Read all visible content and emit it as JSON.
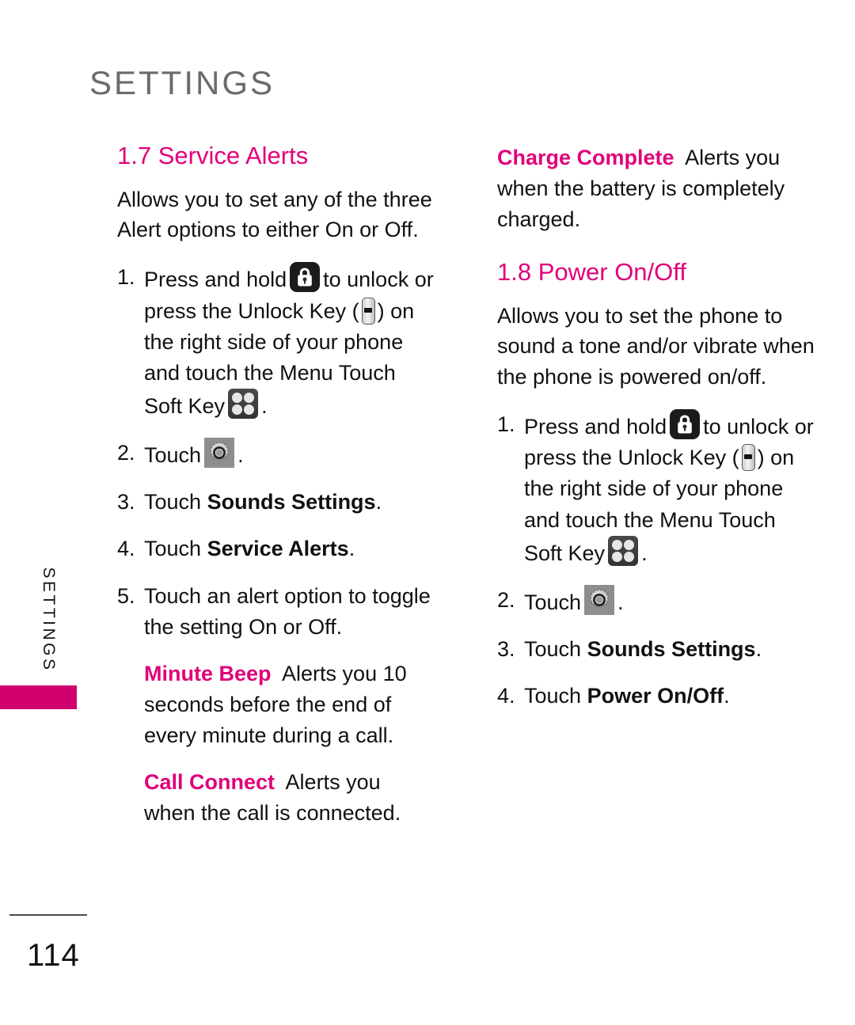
{
  "page": {
    "header_title": "SETTINGS",
    "side_tab_label": "SETTINGS",
    "page_number": "114",
    "accent_color": "#E0007A",
    "bar_color": "#D1006E",
    "header_color": "#6B6B6B"
  },
  "icons": {
    "lock": "padlock-icon",
    "menu": "menu-touch-soft-key-icon",
    "gear": "settings-gear-icon",
    "key": "unlock-side-key-icon"
  },
  "left_column": {
    "section_title": "1.7 Service Alerts",
    "intro": "Allows you to set any of the three Alert options to either On or Off.",
    "steps": [
      {
        "num": "1.",
        "part1": "Press and hold",
        "part2": "to unlock or press the Unlock Key (",
        "part3": ") on the right side of your phone and touch the Menu Touch Soft Key",
        "part4": "."
      },
      {
        "num": "2.",
        "part1": "Touch",
        "part2": "."
      },
      {
        "num": "3.",
        "prefix": "Touch ",
        "bold": "Sounds Settings",
        "suffix": "."
      },
      {
        "num": "4.",
        "prefix": "Touch ",
        "bold": "Service Alerts",
        "suffix": "."
      },
      {
        "num": "5.",
        "text": "Touch an alert option to toggle the setting On or Off."
      }
    ],
    "definitions": [
      {
        "term": "Minute Beep",
        "text": "Alerts you 10 seconds before the end of every minute during a call."
      },
      {
        "term": "Call Connect",
        "text": "Alerts you when the call is connected."
      }
    ]
  },
  "right_column": {
    "definitions": [
      {
        "term": "Charge Complete",
        "text": "Alerts you when the battery is completely charged."
      }
    ],
    "section_title": "1.8 Power On/Off",
    "intro": "Allows you to set the phone to sound a tone and/or vibrate when the phone is powered on/off.",
    "steps": [
      {
        "num": "1.",
        "part1": "Press and hold",
        "part2": "to unlock or press the Unlock Key (",
        "part3": ") on the right side of your phone and touch the Menu Touch Soft Key",
        "part4": "."
      },
      {
        "num": "2.",
        "part1": "Touch",
        "part2": "."
      },
      {
        "num": "3.",
        "prefix": "Touch ",
        "bold": "Sounds Settings",
        "suffix": "."
      },
      {
        "num": "4.",
        "prefix": "Touch ",
        "bold": "Power On/Off",
        "suffix": "."
      }
    ]
  }
}
